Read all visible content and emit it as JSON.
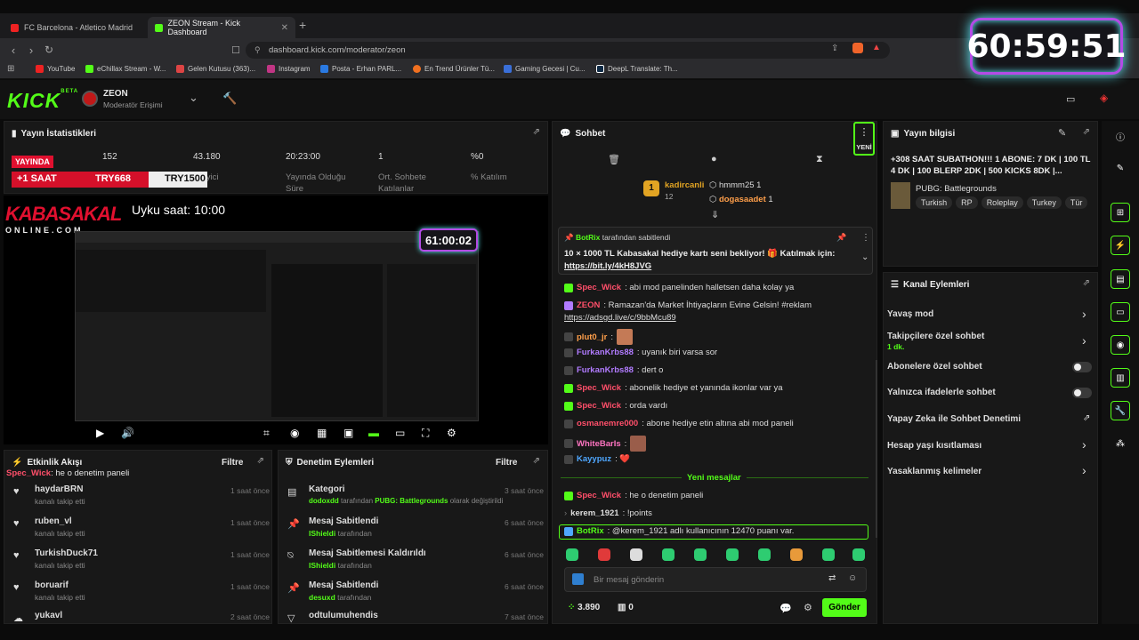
{
  "browser": {
    "tabs": [
      {
        "label": "FC Barcelona - Atletico Madrid - İsp..."
      },
      {
        "label": "ZEON Stream - Kick Dashboard"
      }
    ],
    "url": "dashboard.kick.com/moderator/zeon",
    "bookmarks": [
      "YouTube",
      "eChillax Stream - W...",
      "Gelen Kutusu (363)...",
      "Instagram",
      "Posta - Erhan PARL...",
      "En Trend Ürünler Tü...",
      "Gaming Gecesi | Cu...",
      "DeepL Translate: Th..."
    ]
  },
  "timer": "60:59:51",
  "header": {
    "logo": "KICK",
    "beta": "BETA",
    "channel": "ZEON",
    "role": "Moderatör Erişimi"
  },
  "stats": {
    "title": "Yayın İstatistikleri",
    "live": "YAYINDA",
    "values": [
      "152",
      "43.180",
      "20:23:00",
      "1",
      "%0"
    ],
    "labels": [
      "",
      "İzleyici",
      "Yayında Olduğu Süre",
      "Ort. Sohbete Katılanlar",
      "% Katılım"
    ],
    "overlay_left": "+1 SAAT",
    "overlay_mid": "TRY668",
    "overlay_right": "TRY1500"
  },
  "video": {
    "brand": "KABASAKAL",
    "brand_sub": "ONLINE.COM",
    "sleep": "Uyku saat: 10:00",
    "inner_timer": "61:00:02"
  },
  "activity": {
    "title": "Etkinlik Akışı",
    "filter": "Filtre",
    "top_user": "Spec_Wick",
    "top_msg": ": he o denetim paneli",
    "items": [
      {
        "name": "haydarBRN",
        "sub": "kanalı takip etti",
        "time": "1 saat önce"
      },
      {
        "name": "ruben_vl",
        "sub": "kanalı takip etti",
        "time": "1 saat önce"
      },
      {
        "name": "TurkishDuck71",
        "sub": "kanalı takip etti",
        "time": "1 saat önce"
      },
      {
        "name": "boruarif",
        "sub": "kanalı takip etti",
        "time": "1 saat önce"
      },
      {
        "name": "yukavl",
        "sub": "",
        "time": "2 saat önce"
      }
    ]
  },
  "moderation": {
    "title": "Denetim Eylemleri",
    "filter": "Filtre",
    "items": [
      {
        "name": "Kategori",
        "user": "dodoxdd",
        "mid": " tarafından ",
        "green": "PUBG: Battlegrounds",
        "end": " olarak değiştirildi",
        "time": "3 saat önce"
      },
      {
        "name": "Mesaj Sabitlendi",
        "user": "IShieldi",
        "mid": " tarafından",
        "green": "",
        "end": "",
        "time": "6 saat önce"
      },
      {
        "name": "Mesaj Sabitlemesi Kaldırıldı",
        "user": "IShieldi",
        "mid": " tarafından",
        "green": "",
        "end": "",
        "time": "6 saat önce"
      },
      {
        "name": "Mesaj Sabitlendi",
        "user": "desuxd",
        "mid": " tarafından",
        "green": "",
        "end": "",
        "time": "6 saat önce"
      },
      {
        "name": "odtulumuhendis",
        "user": "",
        "mid": "",
        "green": "",
        "end": "",
        "time": "7 saat önce"
      }
    ]
  },
  "chat": {
    "title": "Sohbet",
    "new_tag": "YENİ",
    "leaders": [
      {
        "name": "kadircanli",
        "score": "12"
      },
      {
        "name": "hmmm25",
        "score": "1"
      },
      {
        "name": "dogasaadet",
        "score": "1"
      }
    ],
    "pinned_by": "BotRix",
    "pinned_suffix": " tarafından sabitlendi",
    "pinned_text": "10 × 1000 TL Kabasakal hediye kartı seni bekliyor! 🎁 Katılmak için:",
    "pinned_link": "https://bit.ly/4kH8JVG",
    "messages": [
      {
        "user": "Spec_Wick",
        "text": ": abi mod panelinden halletsen daha kolay ya"
      },
      {
        "user": "ZEON",
        "text": ": Ramazan'da Market İhtiyaçların Evine Gelsin! #reklam"
      },
      {
        "user": "",
        "text": "https://adsgd.live/c/9bbMcu89"
      },
      {
        "user": "plut0_jr",
        "text": ":"
      },
      {
        "user": "FurkanKrbs88",
        "text": ": uyanık biri varsa sor"
      },
      {
        "user": "FurkanKrbs88",
        "text": ": dert o"
      },
      {
        "user": "Spec_Wick",
        "text": ": abonelik hediye et yanında ikonlar var ya"
      },
      {
        "user": "Spec_Wick",
        "text": ": orda vardı"
      },
      {
        "user": "osmanemre000",
        "text": ": abone hediye etin altına abi mod paneli"
      },
      {
        "user": "WhiteBarIs",
        "text": ":"
      },
      {
        "user": "Kayypuz",
        "text": ": ❤️"
      }
    ],
    "divider": "Yeni mesajlar",
    "new_messages": [
      {
        "user": "Spec_Wick",
        "text": ": he o denetim paneli"
      },
      {
        "user": "kerem_1921",
        "text": ": !points"
      },
      {
        "user": "BotRix",
        "text": ": @kerem_1921 adlı kullanıcının 12470 puanı var."
      }
    ],
    "placeholder": "Bir mesaj gönderin",
    "points": "3.890",
    "count": "0",
    "send": "Gönder"
  },
  "stream_info": {
    "title": "Yayın bilgisi",
    "desc": "+308 SAAT SUBATHON!!! 1 ABONE: 7 DK | 100 TL 4 DK | 100 BLERP 2DK | 500 KICKS 8DK |...",
    "category": "PUBG: Battlegrounds",
    "tags": [
      "Turkish",
      "RP",
      "Roleplay",
      "Turkey",
      "Tür"
    ]
  },
  "channel_actions": {
    "title": "Kanal Eylemleri",
    "items": [
      {
        "label": "Yavaş mod",
        "sub": "",
        "ctrl": "chev"
      },
      {
        "label": "Takipçilere özel sohbet",
        "sub": "1 dk.",
        "ctrl": "chev"
      },
      {
        "label": "Abonelere özel sohbet",
        "sub": "",
        "ctrl": "toggle"
      },
      {
        "label": "Yalnızca ifadelerle sohbet",
        "sub": "",
        "ctrl": "toggle"
      },
      {
        "label": "Yapay Zeka ile Sohbet Denetimi",
        "sub": "",
        "ctrl": "ext"
      },
      {
        "label": "Hesap yaşı kısıtlaması",
        "sub": "",
        "ctrl": "chev"
      },
      {
        "label": "Yasaklanmış kelimeler",
        "sub": "",
        "ctrl": "chev"
      }
    ]
  },
  "colors": {
    "kick_green": "#53fc18",
    "live_red": "#e0102f"
  }
}
